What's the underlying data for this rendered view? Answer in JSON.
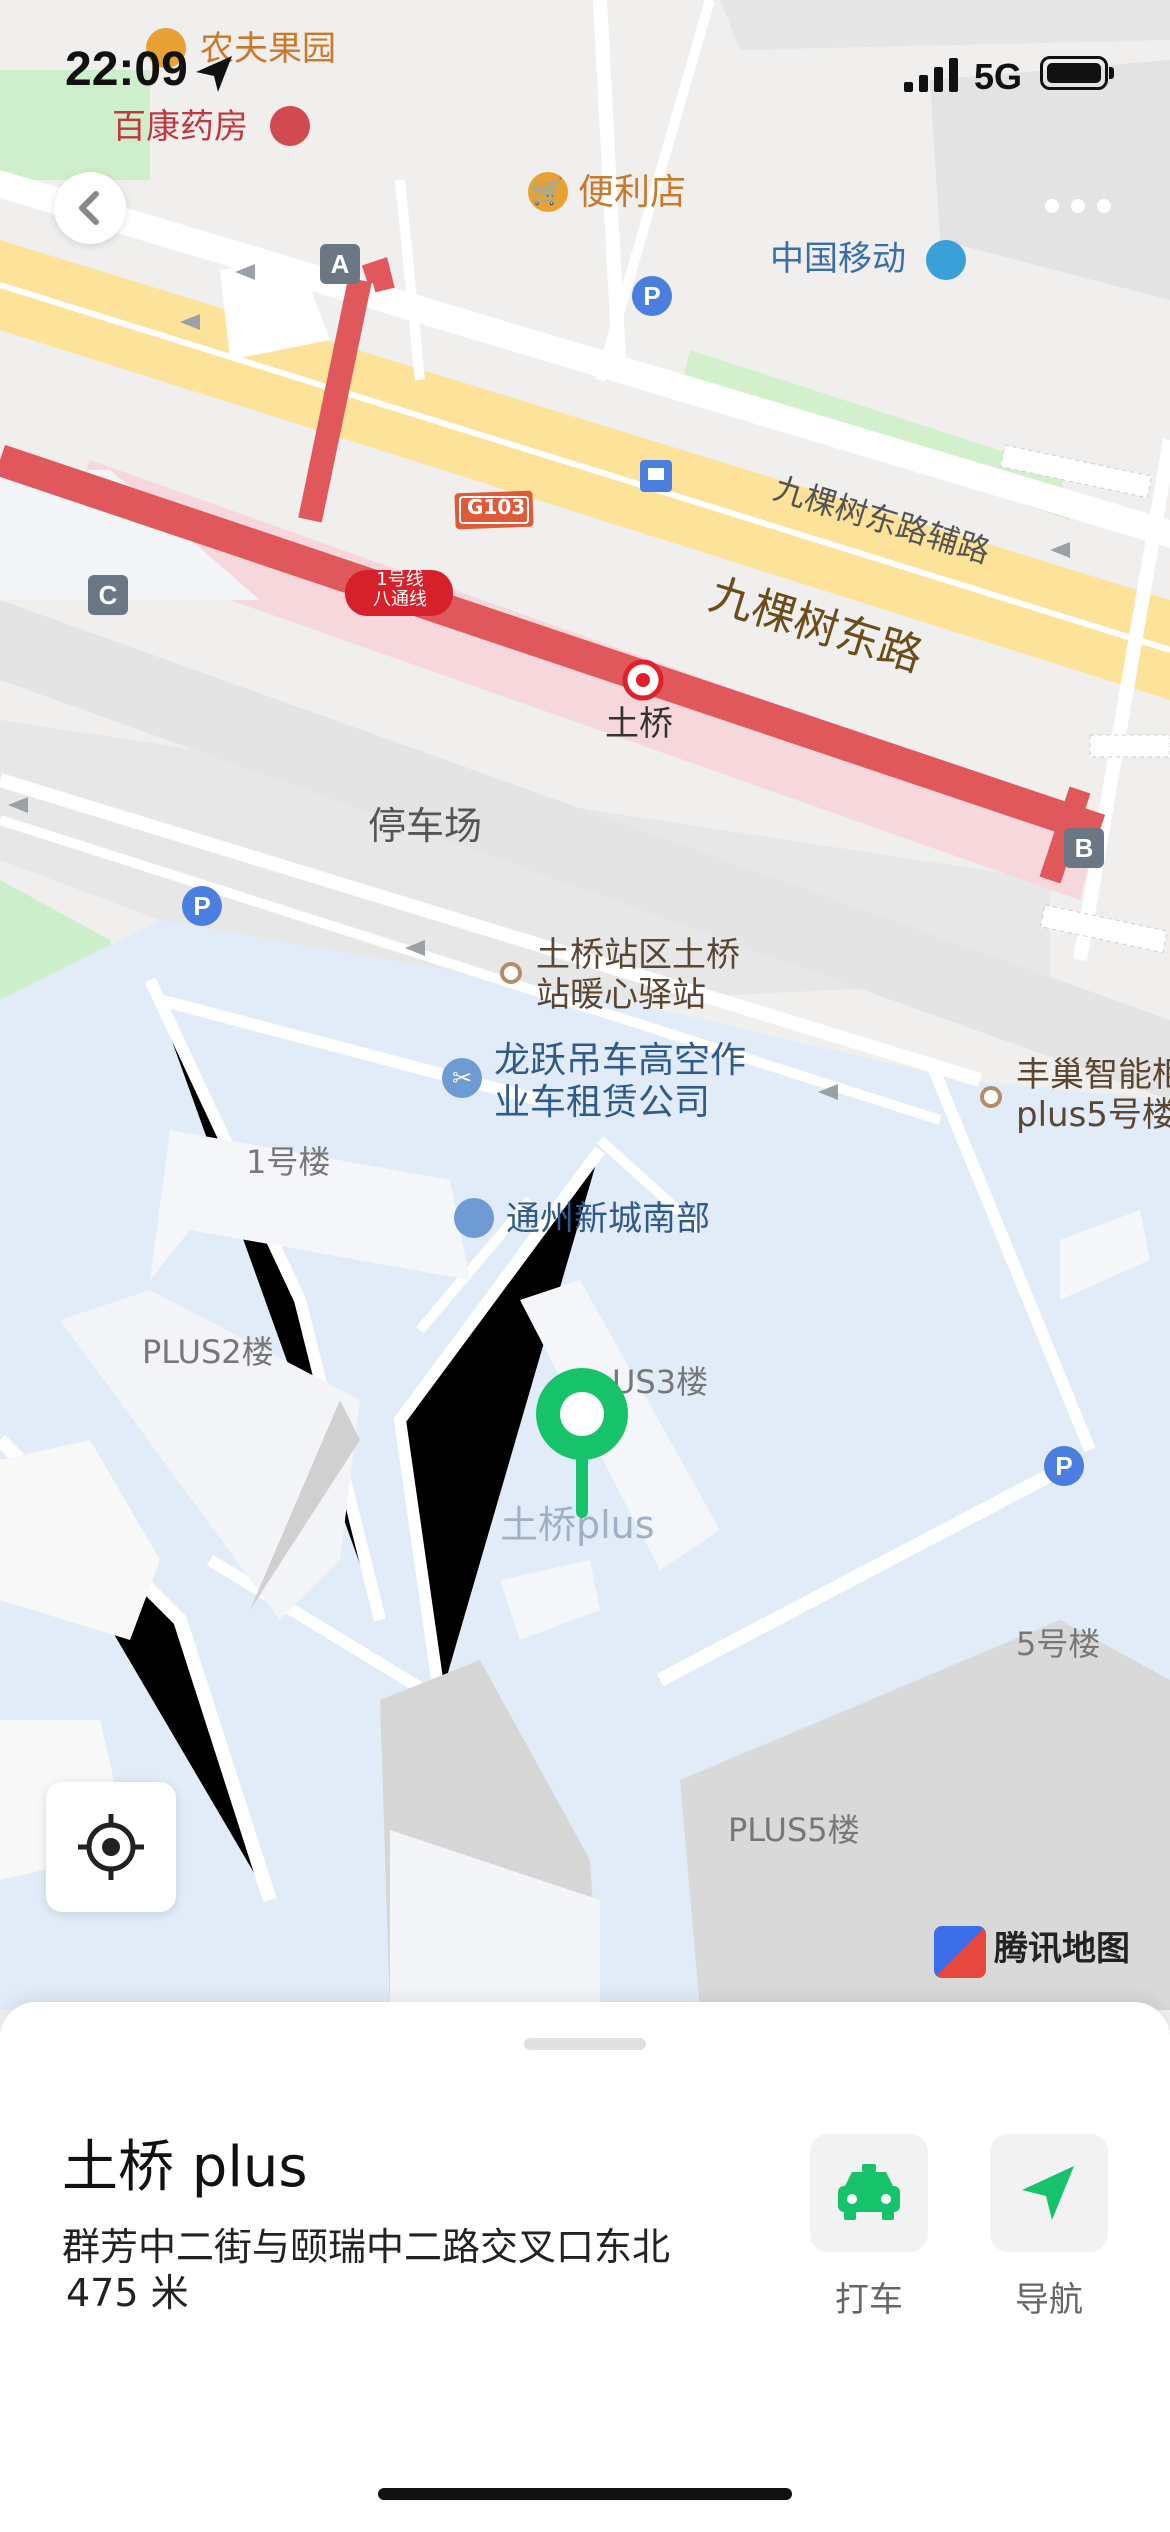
{
  "status_bar": {
    "time": "22:09",
    "network": "5G"
  },
  "map": {
    "labels": {
      "road_main": "九棵树东路",
      "road_aux": "九棵树东路辅路",
      "metro_line": "1号线\n八通线",
      "route_shield": "G103",
      "metro_station": "土桥",
      "parking_lot": "停车场",
      "poi_farmer_orchard": "农夫果园",
      "poi_pharmacy": "百康药房",
      "poi_convenience": "便利店",
      "poi_china_mobile": "中国移动",
      "poi_heart_station_line1": "土桥站区土桥",
      "poi_heart_station_line2": "站暖心驿站",
      "poi_crane_line1": "龙跃吊车高空作",
      "poi_crane_line2": "业车租赁公司",
      "poi_hive_line1": "丰巢智能柜",
      "poi_hive_line2": "plus5号楼",
      "bldg_1": "1号楼",
      "poi_tongzhou": "通州新城南部",
      "bldg_plus2": "PLUS2楼",
      "bldg_plus3": "US3楼",
      "place_tuqiao_plus": "土桥plus",
      "bldg_5": "5号楼",
      "bldg_plus5": "PLUS5楼",
      "exit_a": "A",
      "exit_b": "B",
      "exit_c": "C",
      "parking_icon": "P",
      "watermark": "腾讯地图"
    },
    "colors": {
      "pin": "#17c36a",
      "metro": "#e0585c",
      "road_major": "#fde29a",
      "campus": "#e1ecf8",
      "green": "#d5f0cf"
    }
  },
  "place_card": {
    "title": "土桥 plus",
    "address": "群芳中二街与颐瑞中二路交叉口东北",
    "distance": "475 米",
    "actions": [
      {
        "label": "打车",
        "icon": "taxi-icon"
      },
      {
        "label": "导航",
        "icon": "navigation-arrow-icon"
      }
    ]
  }
}
